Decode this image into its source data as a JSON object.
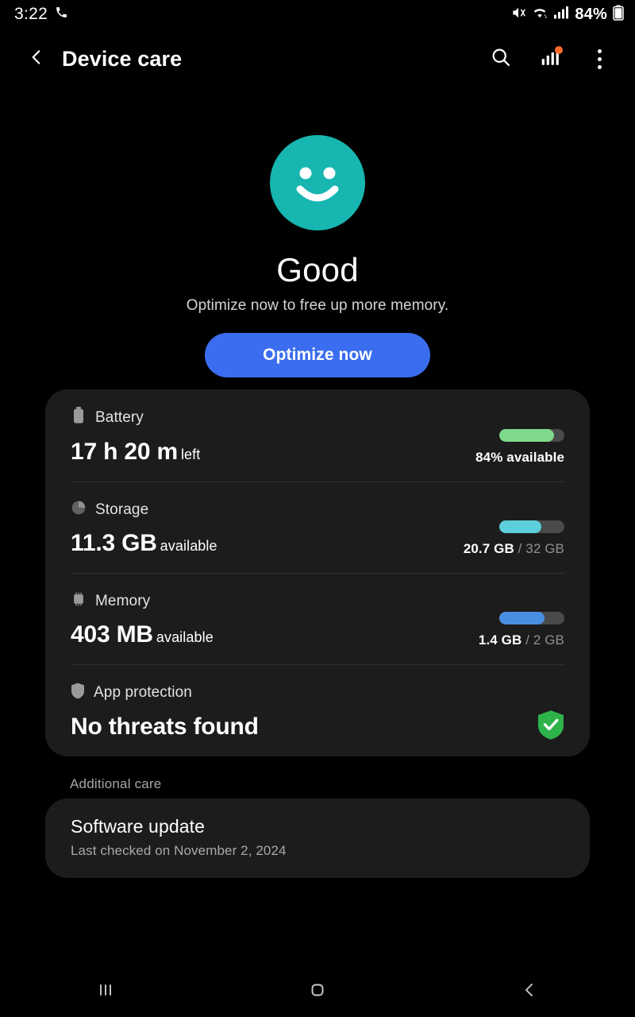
{
  "status_bar": {
    "time": "3:22",
    "battery_percent": "84%",
    "icons": [
      "phone-call-icon",
      "mute-icon",
      "wifi-icon",
      "signal-icon",
      "battery-icon"
    ]
  },
  "app_bar": {
    "title": "Device care",
    "back_icon": "chevron-left-icon",
    "actions": [
      "search-icon",
      "usage-chart-icon",
      "more-options-icon"
    ],
    "badge_color": "#ff6b2c"
  },
  "hero": {
    "face_icon": "smiley-face-icon",
    "face_color": "#17b6b0",
    "status": "Good",
    "subtitle": "Optimize now to free up more memory.",
    "button_label": "Optimize now",
    "button_color": "#3b6df0"
  },
  "status_card": {
    "rows": [
      {
        "icon": "battery-icon",
        "label": "Battery",
        "value": "17 h 20 m",
        "unit": "left",
        "meta_primary": "84% available",
        "meta_secondary": "",
        "fill_percent": 84,
        "fill_color": "#7ed98a"
      },
      {
        "icon": "storage-pie-icon",
        "label": "Storage",
        "value": "11.3 GB",
        "unit": "available",
        "meta_primary": "20.7 GB",
        "meta_secondary": " / 32 GB",
        "fill_percent": 65,
        "fill_color": "#5ccfdb"
      },
      {
        "icon": "memory-chip-icon",
        "label": "Memory",
        "value": "403 MB",
        "unit": "available",
        "meta_primary": "1.4 GB",
        "meta_secondary": " / 2 GB",
        "fill_percent": 70,
        "fill_color": "#4a90e2"
      },
      {
        "icon": "shield-icon",
        "label": "App protection",
        "value": "No threats found",
        "unit": "",
        "meta_primary": "",
        "meta_secondary": "",
        "status_icon": "shield-check-icon",
        "status_color": "#2eb34a"
      }
    ]
  },
  "additional_care": {
    "section_label": "Additional care",
    "software_update": {
      "title": "Software update",
      "subtitle": "Last checked on November 2, 2024"
    }
  },
  "nav_bar": {
    "recents_icon": "recents-icon",
    "home_icon": "home-icon",
    "back_icon": "back-icon"
  }
}
